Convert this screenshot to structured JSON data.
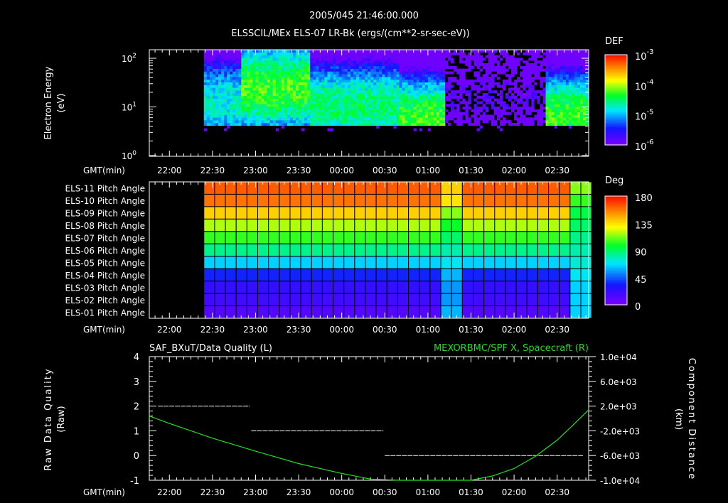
{
  "header": {
    "timestamp": "2005/045 21:46:00.000",
    "title": "ELSSCIL/MEx ELS-07 LR-Bk  (ergs/(cm**2-sr-sec-eV))"
  },
  "time_axis": {
    "label": "GMT(min)",
    "start": "21:46",
    "end": "02:52",
    "ticks": [
      "22:00",
      "22:30",
      "23:00",
      "23:30",
      "00:00",
      "00:30",
      "01:00",
      "01:30",
      "02:00",
      "02:30"
    ]
  },
  "colors": {
    "axes": "#ffffff",
    "curve": "#1ee01e",
    "background": "#000000"
  },
  "chart_data": [
    {
      "type": "heatmap",
      "name": "energy-spectrogram",
      "ylabel": "Electron Energy",
      "yunit": "(eV)",
      "yscale": "log",
      "ylim": [
        1,
        150
      ],
      "yticks": [
        {
          "base": "10",
          "exp": "0",
          "v": 1
        },
        {
          "base": "10",
          "exp": "1",
          "v": 10
        },
        {
          "base": "10",
          "exp": "2",
          "v": 100
        }
      ],
      "colorbar": {
        "title": "DEF",
        "scale": "log",
        "range_log": [
          -6,
          -3
        ],
        "ticks": [
          {
            "base": "10",
            "exp": "-3",
            "v": -3
          },
          {
            "base": "10",
            "exp": "-4",
            "v": -4
          },
          {
            "base": "10",
            "exp": "-5",
            "v": -5
          },
          {
            "base": "10",
            "exp": "-6",
            "v": -6
          }
        ]
      },
      "segments": [
        {
          "start": "22:24",
          "end": "22:50",
          "cutoff_eV": 4,
          "peak_log": -4.6,
          "peak_eV": 15
        },
        {
          "start": "22:50",
          "end": "23:38",
          "cutoff_eV": 4,
          "peak_log": -4.0,
          "peak_eV": 30
        },
        {
          "start": "23:38",
          "end": "00:40",
          "cutoff_eV": 4,
          "peak_log": -4.4,
          "peak_eV": 12
        },
        {
          "start": "00:40",
          "end": "01:12",
          "cutoff_eV": 4,
          "peak_log": -4.2,
          "peak_eV": 6
        },
        {
          "start": "01:12",
          "end": "02:22",
          "cutoff_eV": 4,
          "peak_log": -5.7,
          "peak_eV": 20
        },
        {
          "start": "02:22",
          "end": "02:52",
          "cutoff_eV": 4,
          "peak_log": -4.2,
          "peak_eV": 7
        }
      ]
    },
    {
      "type": "heatmap",
      "name": "pitch-angle",
      "rows": [
        {
          "label": "ELS-11 Pitch Angle",
          "deg": 165
        },
        {
          "label": "ELS-10 Pitch Angle",
          "deg": 160
        },
        {
          "label": "ELS-09 Pitch Angle",
          "deg": 140
        },
        {
          "label": "ELS-08 Pitch Angle",
          "deg": 120
        },
        {
          "label": "ELS-07 Pitch Angle",
          "deg": 105
        },
        {
          "label": "ELS-06 Pitch Angle",
          "deg": 85
        },
        {
          "label": "ELS-05 Pitch Angle",
          "deg": 65
        },
        {
          "label": "ELS-04 Pitch Angle",
          "deg": 35
        },
        {
          "label": "ELS-03 Pitch Angle",
          "deg": 22
        },
        {
          "label": "ELS-02 Pitch Angle",
          "deg": 18
        },
        {
          "label": "ELS-01 Pitch Angle",
          "deg": 12
        }
      ],
      "data_start": "22:24",
      "bin_minutes": 7.5,
      "disturbances": [
        {
          "start": "01:10",
          "end": "01:27",
          "deg": [
            140,
            135,
            115,
            100,
            90,
            80,
            70,
            60,
            55,
            55,
            60
          ]
        },
        {
          "start": "02:40",
          "end": "02:52",
          "deg": [
            115,
            105,
            95,
            90,
            85,
            80,
            75,
            70,
            65,
            65,
            65
          ]
        }
      ],
      "colorbar": {
        "title": "Deg",
        "range": [
          0,
          180
        ],
        "ticks": [
          "0",
          "45",
          "90",
          "135",
          "180"
        ]
      }
    },
    {
      "type": "line",
      "name": "data-quality-and-position",
      "left_title": "SAF_BXuT/Data Quality (L)",
      "right_title": "MEXORBMC/SPF X, Spacecraft (R)",
      "ylabel_left": "Raw  Data  Quality",
      "ylabel_left_unit": "(Raw)",
      "ylabel_right": "Component  Distance",
      "ylabel_right_unit": "(km)",
      "ylim_left": [
        -1,
        4
      ],
      "yticks_left": [
        "4",
        "3",
        "2",
        "1",
        "0",
        "-1"
      ],
      "ylim_right": [
        -10000,
        10000
      ],
      "yticks_right": [
        "1.0e+04",
        "6.0e+03",
        "2.0e+03",
        "-2.0e+03",
        "-6.0e+03",
        "-1.0e+04"
      ],
      "quality_series": [
        {
          "start": "21:52",
          "end": "22:56",
          "value": 2
        },
        {
          "start": "22:57",
          "end": "00:29",
          "value": 1
        },
        {
          "start": "00:30",
          "end": "02:48",
          "value": 0
        }
      ],
      "position_series": {
        "t": [
          "21:46",
          "22:00",
          "22:30",
          "23:00",
          "23:30",
          "00:00",
          "00:20",
          "00:40",
          "01:00",
          "01:20",
          "01:30",
          "01:45",
          "02:00",
          "02:15",
          "02:30",
          "02:40",
          "02:52"
        ],
        "x_km": [
          400,
          -800,
          -3200,
          -5300,
          -7300,
          -8900,
          -9800,
          -10600,
          -10900,
          -10400,
          -10000,
          -9300,
          -8100,
          -6100,
          -3500,
          -1300,
          1400
        ]
      }
    }
  ]
}
